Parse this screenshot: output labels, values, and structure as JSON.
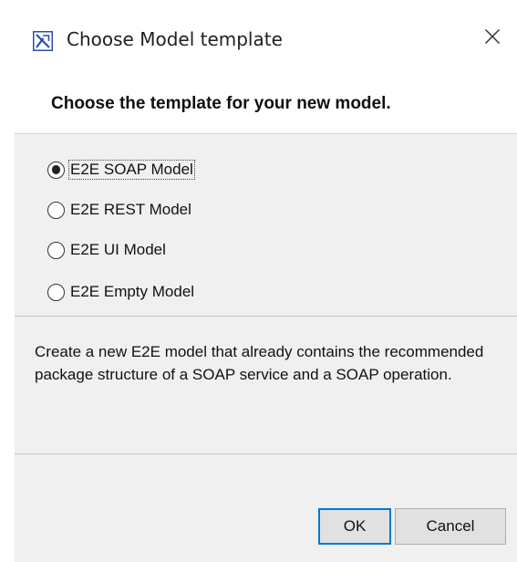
{
  "window": {
    "title": "Choose Model template",
    "icon": "model-app-icon",
    "close_icon": "close-icon"
  },
  "header": {
    "text": "Choose the template for your new model."
  },
  "templates": {
    "selected": "E2E SOAP Model",
    "options": [
      {
        "label": "E2E SOAP Model",
        "checked": true
      },
      {
        "label": "E2E REST Model",
        "checked": false
      },
      {
        "label": "E2E UI Model",
        "checked": false
      },
      {
        "label": "E2E Empty Model",
        "checked": false
      }
    ]
  },
  "description": "Create a new E2E model that already contains the recommended package structure of a SOAP service and a SOAP operation.",
  "buttons": {
    "ok_label": "OK",
    "cancel_label": "Cancel"
  },
  "colors": {
    "panel_bg": "#f0f0f0",
    "focus_border": "#0078d7",
    "icon_blue": "#2b4fa8"
  }
}
